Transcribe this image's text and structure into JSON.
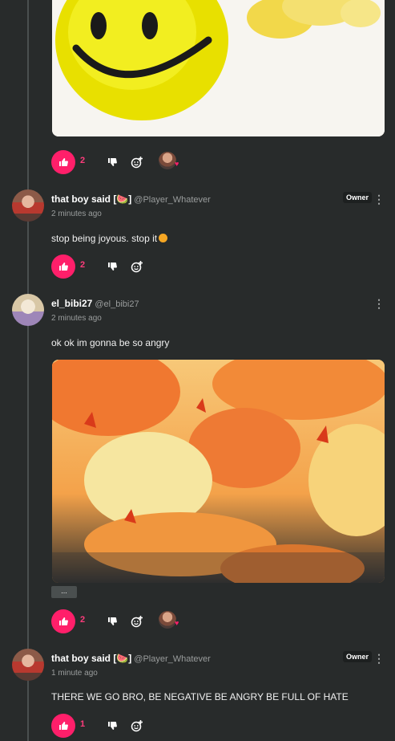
{
  "comments": [
    {
      "media_alt": "yellow smiley face gif",
      "likes": "2",
      "has_reactor": true
    },
    {
      "name": "that boy said [🍉]",
      "handle": "@Player_Whatever",
      "badge": "Owner",
      "time": "2 minutes ago",
      "text": "stop being joyous. stop it",
      "likes": "2",
      "has_reactor": false
    },
    {
      "name": "el_bibi27",
      "handle": "@el_bibi27",
      "time": "2 minutes ago",
      "text": "ok ok im gonna be so angry",
      "media_alt": "fiery orange explosion gif",
      "caption_tag": "...",
      "likes": "2",
      "has_reactor": true
    },
    {
      "name": "that boy said [🍉]",
      "handle": "@Player_Whatever",
      "badge": "Owner",
      "time": "1 minute ago",
      "text": "THERE WE GO BRO, BE NEGATIVE BE ANGRY BE FULL OF HATE",
      "likes": "1",
      "has_reactor": false
    }
  ],
  "icons": {
    "like": "thumbs-up-icon",
    "dislike": "thumbs-down-icon",
    "react": "add-reaction-icon",
    "more": "more-vertical-icon",
    "reactor_heart": "heart-icon"
  },
  "colors": {
    "background": "#282b2b",
    "like_accent": "#ff1f6a",
    "text_muted": "#9a9d9d"
  }
}
